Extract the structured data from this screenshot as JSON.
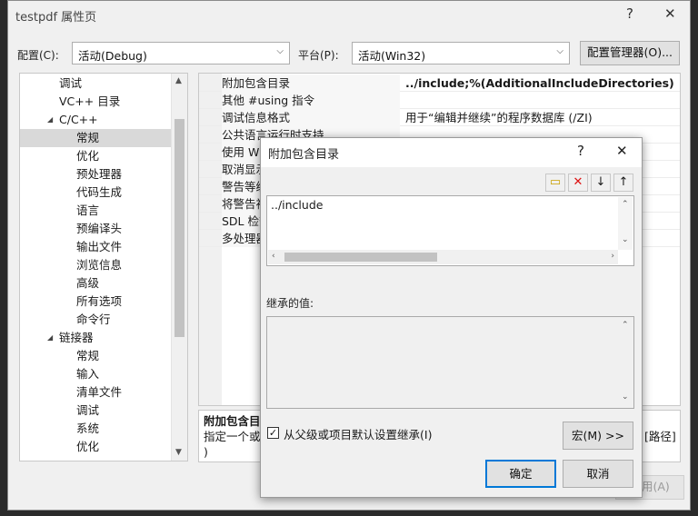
{
  "window": {
    "title": "testpdf 属性页",
    "help": "?",
    "close": "✕"
  },
  "config": {
    "config_label": "配置(C):",
    "config_value": "活动(Debug)",
    "platform_label": "平台(P):",
    "platform_value": "活动(Win32)",
    "manager_button": "配置管理器(O)..."
  },
  "tree": {
    "items": [
      {
        "label": "调试",
        "indent": 1
      },
      {
        "label": "VC++ 目录",
        "indent": 1
      },
      {
        "label": "C/C++",
        "indent": 1,
        "expanded": true
      },
      {
        "label": "常规",
        "indent": 2,
        "selected": true
      },
      {
        "label": "优化",
        "indent": 2
      },
      {
        "label": "预处理器",
        "indent": 2
      },
      {
        "label": "代码生成",
        "indent": 2
      },
      {
        "label": "语言",
        "indent": 2
      },
      {
        "label": "预编译头",
        "indent": 2
      },
      {
        "label": "输出文件",
        "indent": 2
      },
      {
        "label": "浏览信息",
        "indent": 2
      },
      {
        "label": "高级",
        "indent": 2
      },
      {
        "label": "所有选项",
        "indent": 2
      },
      {
        "label": "命令行",
        "indent": 2
      },
      {
        "label": "链接器",
        "indent": 1,
        "expanded": true
      },
      {
        "label": "常规",
        "indent": 2
      },
      {
        "label": "输入",
        "indent": 2
      },
      {
        "label": "清单文件",
        "indent": 2
      },
      {
        "label": "调试",
        "indent": 2
      },
      {
        "label": "系统",
        "indent": 2
      },
      {
        "label": "优化",
        "indent": 2
      }
    ]
  },
  "grid": {
    "rows": [
      {
        "name": "附加包含目录",
        "value": "../include;%(AdditionalIncludeDirectories)",
        "bold": true
      },
      {
        "name": "其他 #using 指令",
        "value": ""
      },
      {
        "name": "调试信息格式",
        "value": "用于“编辑并继续”的程序数据库 (/ZI)"
      },
      {
        "name": "公共语言运行时支持",
        "value": ""
      },
      {
        "name": "使用 Wi",
        "value": ""
      },
      {
        "name": "取消显示",
        "value": ""
      },
      {
        "name": "警告等级",
        "value": ""
      },
      {
        "name": "将警告视",
        "value": ""
      },
      {
        "name": "SDL 检查",
        "value": ""
      },
      {
        "name": "多处理器",
        "value": ""
      }
    ]
  },
  "description": {
    "title": "附加包含目录",
    "line1": "指定一个或多",
    "line2": ")",
    "path_hint": "[路径]"
  },
  "bottom_buttons": {
    "apply": "用(A)"
  },
  "dialog": {
    "title": "附加包含目录",
    "help": "?",
    "close": "✕",
    "entries": [
      "../include"
    ],
    "inherited_label": "继承的值:",
    "inherit_checkbox_label": "从父级或项目默认设置继承(I)",
    "inherit_checked": true,
    "macro_button": "宏(M) >>",
    "ok_button": "确定",
    "cancel_button": "取消"
  }
}
